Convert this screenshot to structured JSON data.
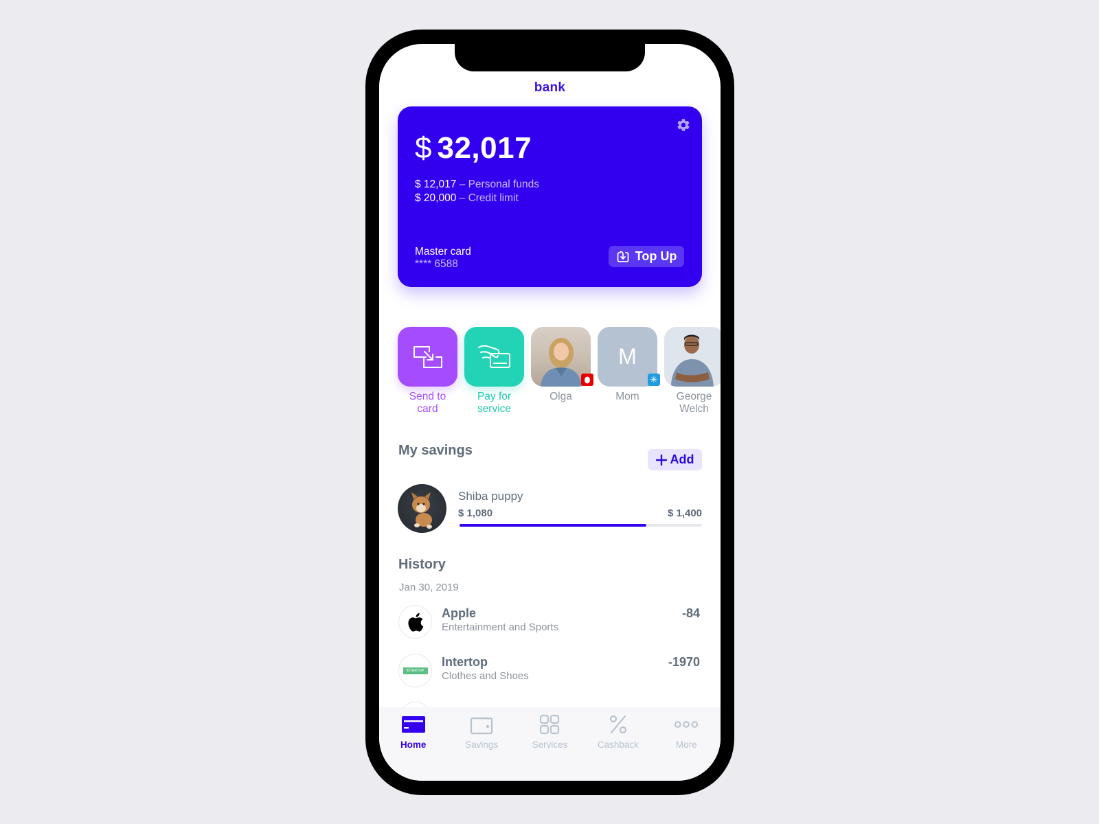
{
  "app": {
    "logo_text": "bank",
    "accent_color": "#3300ef"
  },
  "card": {
    "currency_symbol": "$",
    "total_amount": "32,017",
    "breakdown": [
      {
        "value": "$ 12,017",
        "separator": " – ",
        "label": "Personal funds"
      },
      {
        "value": "$ 20,000",
        "separator": " – ",
        "label": "Credit limit"
      }
    ],
    "card_name": "Master card",
    "card_number": "**** 6588",
    "top_up_label": "Top Up",
    "settings_icon": "gear-icon",
    "top_up_icon": "download-tray-icon"
  },
  "quick_actions": [
    {
      "type": "action",
      "label": "Send to card",
      "icon": "transfer-icon",
      "color": "#a54cff"
    },
    {
      "type": "action",
      "label": "Pay for service",
      "icon": "hand-card-icon",
      "color": "#22d3b6"
    },
    {
      "type": "contact",
      "label": "Olga",
      "badge": "vodafone-badge-icon"
    },
    {
      "type": "contact",
      "label": "Mom",
      "initial": "M",
      "badge": "kyivstar-badge-icon"
    },
    {
      "type": "contact",
      "label": "George Welch",
      "badge": "carrier-badge-icon"
    }
  ],
  "savings": {
    "title": "My savings",
    "add_label": "Add",
    "items": [
      {
        "name": "Shiba puppy",
        "current": "$ 1,080",
        "goal": "$ 1,400",
        "progress": 0.771
      }
    ]
  },
  "history": {
    "title": "History",
    "groups": [
      {
        "date": "Jan 30, 2019",
        "transactions": [
          {
            "merchant": "Apple",
            "category": "Entertainment and Sports",
            "amount": "-84",
            "logo": "apple-logo-icon"
          },
          {
            "merchant": "Intertop",
            "category": "Clothes and Shoes",
            "amount": "-1970",
            "logo": "intertop-logo-icon",
            "logo_text": "INTERTOP"
          }
        ]
      }
    ]
  },
  "tabbar": {
    "active": "Home",
    "tabs": [
      {
        "label": "Home",
        "icon": "card-icon"
      },
      {
        "label": "Savings",
        "icon": "wallet-icon"
      },
      {
        "label": "Services",
        "icon": "grid-icon"
      },
      {
        "label": "Cashback",
        "icon": "percent-icon"
      },
      {
        "label": "More",
        "icon": "more-dots-icon"
      }
    ]
  }
}
